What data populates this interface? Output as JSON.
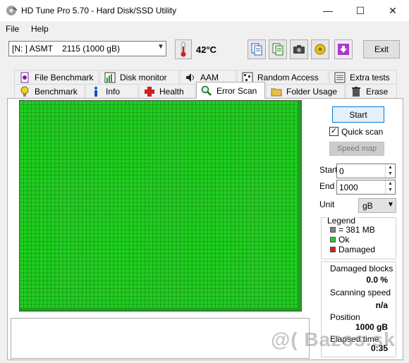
{
  "window": {
    "title": "HD Tune Pro 5.70 - Hard Disk/SSD Utility",
    "controls": {
      "minimize": "—",
      "maximize": "☐",
      "close": "✕"
    }
  },
  "menu": {
    "file": "File",
    "help": "Help"
  },
  "toolbar": {
    "drive": "[N: ] ASMT    2115 (1000 gB)",
    "temperature": "42°C",
    "exit_label": "Exit"
  },
  "tabs": {
    "row1": [
      "File Benchmark",
      "Disk monitor",
      "AAM",
      "Random Access",
      "Extra tests"
    ],
    "row2": [
      "Benchmark",
      "Info",
      "Health",
      "Error Scan",
      "Folder Usage",
      "Erase"
    ],
    "active": "Error Scan"
  },
  "scan": {
    "start_label": "Start",
    "quick_scan_label": "Quick scan",
    "quick_scan_checked": "✓",
    "speed_map_label": "Speed map",
    "start_field_label": "Start",
    "start_value": "0",
    "end_field_label": "End",
    "end_value": "1000",
    "unit_label": "Unit",
    "unit_value": "gB",
    "grid_progress": 1.0
  },
  "legend": {
    "title": "Legend",
    "block_size": "= 381 MB",
    "ok": "Ok",
    "damaged": "Damaged",
    "colors": {
      "ok": "#1fd01f",
      "damaged": "#d01f1f",
      "block": "#808080"
    }
  },
  "stats": {
    "damaged_blocks_label": "Damaged blocks",
    "damaged_blocks_value": "0.0 %",
    "scanning_speed_label": "Scanning speed",
    "scanning_speed_value": "n/a",
    "position_label": "Position",
    "position_value": "1000 gB",
    "elapsed_time_label": "Elapsed time",
    "elapsed_time_value": "0:35"
  },
  "watermark": "@( Bazos.sk"
}
